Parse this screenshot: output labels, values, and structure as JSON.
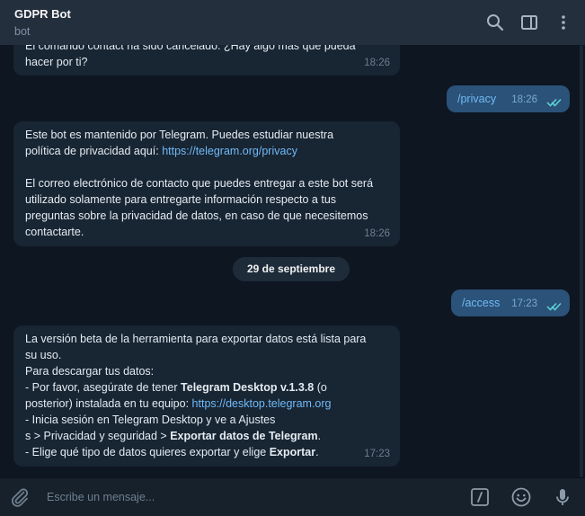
{
  "header": {
    "title": "GDPR Bot",
    "subtitle": "bot",
    "icons": [
      "search-icon",
      "sidebar-toggle-icon",
      "more-vertical-icon"
    ]
  },
  "messages": {
    "m1": {
      "text": "El comando contact ha sido cancelado. ¿Hay algo más que pueda hacer por ti?",
      "time": "18:26"
    },
    "m2": {
      "text": "/privacy",
      "time": "18:26"
    },
    "m3": {
      "line1": "Este bot es mantenido por Telegram. Puedes estudiar nuestra",
      "line2_prefix": "política de privacidad aquí: ",
      "link": "https://telegram.org/privacy",
      "para2": "El correo electrónico de contacto que puedes entregar a este bot será utilizado solamente para entregarte información respecto a tus preguntas sobre la privacidad de datos, en caso de que necesitemos contactarte.",
      "time": "18:26"
    },
    "date_separator": "29 de septiembre",
    "m4": {
      "text": "/access",
      "time": "17:23"
    },
    "m5": {
      "line1": "La versión beta de la herramienta para exportar datos está lista para su uso.",
      "line2": "Para descargar tus datos:",
      "b1_prefix": "- Por favor, asegúrate de tener ",
      "b1_bold": "Telegram Desktop v.1.3.8",
      "b1_suffix": " (o posterior) instalada en tu equipo: ",
      "b1_link": "https://desktop.telegram.org",
      "b2_line1": "- Inicia sesión en Telegram Desktop y ve a Ajustes",
      "b2_prefix": "s > Privacidad y seguridad > ",
      "b2_bold": "Exportar datos de Telegram",
      "b2_suffix": ".",
      "b3_prefix": "- Elige qué tipo de datos quieres exportar y elige ",
      "b3_bold": "Exportar",
      "b3_suffix": ".",
      "time": "17:23"
    }
  },
  "composer": {
    "placeholder": "Escribe un mensaje...",
    "icons": [
      "attach-icon",
      "bot-command-icon",
      "emoji-icon",
      "microphone-icon"
    ]
  },
  "colors": {
    "background": "#0e1621",
    "header": "#242f3d",
    "incoming_bubble": "#182533",
    "outgoing_bubble": "#2b5278",
    "link": "#71baf6",
    "read_tick": "#5fd3d8"
  }
}
